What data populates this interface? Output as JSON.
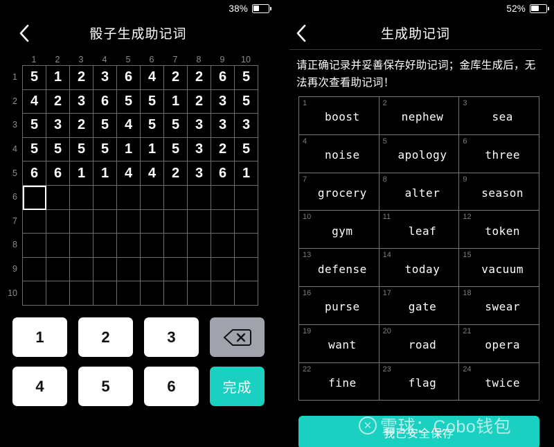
{
  "colors": {
    "accent_teal": "#1ad0c0",
    "background": "#000000",
    "key_white": "#ffffff",
    "key_delete_gray": "#a0a3ac",
    "grid_line": "#6e6e6e",
    "muted_text": "#8d8d8d"
  },
  "left_panel": {
    "status": {
      "battery_percent": "38%",
      "battery_level": 38
    },
    "nav": {
      "back_icon": "chevron-left-icon",
      "title": "骰子生成助记词"
    },
    "grid": {
      "column_headers": [
        "1",
        "2",
        "3",
        "4",
        "5",
        "6",
        "7",
        "8",
        "9",
        "10"
      ],
      "row_headers": [
        "1",
        "2",
        "3",
        "4",
        "5",
        "6",
        "7",
        "8",
        "9",
        "10"
      ],
      "rows": [
        [
          "5",
          "1",
          "2",
          "3",
          "6",
          "4",
          "2",
          "2",
          "6",
          "5"
        ],
        [
          "4",
          "2",
          "3",
          "6",
          "5",
          "5",
          "1",
          "2",
          "3",
          "5"
        ],
        [
          "5",
          "3",
          "2",
          "5",
          "4",
          "5",
          "5",
          "3",
          "3",
          "3"
        ],
        [
          "5",
          "5",
          "5",
          "5",
          "1",
          "1",
          "5",
          "3",
          "2",
          "5"
        ],
        [
          "6",
          "6",
          "1",
          "1",
          "4",
          "4",
          "2",
          "3",
          "6",
          "1"
        ],
        [
          "",
          "",
          "",
          "",
          "",
          "",
          "",
          "",
          "",
          ""
        ],
        [
          "",
          "",
          "",
          "",
          "",
          "",
          "",
          "",
          "",
          ""
        ],
        [
          "",
          "",
          "",
          "",
          "",
          "",
          "",
          "",
          "",
          ""
        ],
        [
          "",
          "",
          "",
          "",
          "",
          "",
          "",
          "",
          "",
          ""
        ],
        [
          "",
          "",
          "",
          "",
          "",
          "",
          "",
          "",
          "",
          ""
        ]
      ],
      "active_cell": {
        "row": 6,
        "col": 1
      }
    },
    "keypad": {
      "keys": [
        {
          "label": "1",
          "type": "num",
          "name": "key-1"
        },
        {
          "label": "2",
          "type": "num",
          "name": "key-2"
        },
        {
          "label": "3",
          "type": "num",
          "name": "key-3"
        },
        {
          "label": "",
          "type": "del",
          "name": "backspace-button",
          "icon": "backspace-icon"
        },
        {
          "label": "4",
          "type": "num",
          "name": "key-4"
        },
        {
          "label": "5",
          "type": "num",
          "name": "key-5"
        },
        {
          "label": "6",
          "type": "num",
          "name": "key-6"
        },
        {
          "label": "完成",
          "type": "done",
          "name": "done-button"
        }
      ]
    }
  },
  "right_panel": {
    "status": {
      "battery_percent": "52%",
      "battery_level": 52
    },
    "nav": {
      "back_icon": "chevron-left-icon",
      "title": "生成助记词"
    },
    "notice": "请正确记录并妥善保存好助记词；金库生成后，无法再次查看助记词！",
    "words": [
      {
        "index": "1",
        "word": "boost"
      },
      {
        "index": "2",
        "word": "nephew"
      },
      {
        "index": "3",
        "word": "sea"
      },
      {
        "index": "4",
        "word": "noise"
      },
      {
        "index": "5",
        "word": "apology"
      },
      {
        "index": "6",
        "word": "three"
      },
      {
        "index": "7",
        "word": "grocery"
      },
      {
        "index": "8",
        "word": "alter"
      },
      {
        "index": "9",
        "word": "season"
      },
      {
        "index": "10",
        "word": "gym"
      },
      {
        "index": "11",
        "word": "leaf"
      },
      {
        "index": "12",
        "word": "token"
      },
      {
        "index": "13",
        "word": "defense"
      },
      {
        "index": "14",
        "word": "today"
      },
      {
        "index": "15",
        "word": "vacuum"
      },
      {
        "index": "16",
        "word": "purse"
      },
      {
        "index": "17",
        "word": "gate"
      },
      {
        "index": "18",
        "word": "swear"
      },
      {
        "index": "19",
        "word": "want"
      },
      {
        "index": "20",
        "word": "road"
      },
      {
        "index": "21",
        "word": "opera"
      },
      {
        "index": "22",
        "word": "fine"
      },
      {
        "index": "23",
        "word": "flag"
      },
      {
        "index": "24",
        "word": "twice"
      }
    ],
    "save_button_label": "我已安全保存"
  },
  "watermark": {
    "logo": "snowball-logo-icon",
    "text": "雪球：Cobo钱包"
  }
}
